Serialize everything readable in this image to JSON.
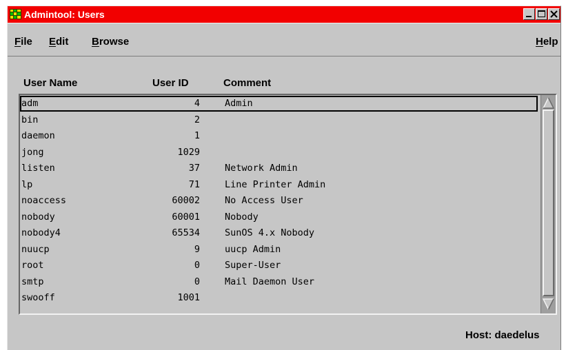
{
  "window": {
    "title": "Admintool: Users",
    "colors": {
      "titlebar": "#f20000",
      "title_text": "#ffffff",
      "background": "#c6c6c6"
    }
  },
  "menubar": {
    "file": {
      "mnemonic": "F",
      "rest": "ile"
    },
    "edit": {
      "mnemonic": "E",
      "rest": "dit"
    },
    "browse": {
      "mnemonic": "B",
      "rest": "rowse"
    },
    "help": {
      "mnemonic": "H",
      "rest": "elp"
    }
  },
  "table": {
    "columns": [
      "User Name",
      "User ID",
      "Comment"
    ],
    "selected_index": 0,
    "rows": [
      {
        "name": "adm",
        "id": "4",
        "comment": "Admin"
      },
      {
        "name": "bin",
        "id": "2",
        "comment": ""
      },
      {
        "name": "daemon",
        "id": "1",
        "comment": ""
      },
      {
        "name": "jong",
        "id": "1029",
        "comment": ""
      },
      {
        "name": "listen",
        "id": "37",
        "comment": "Network Admin"
      },
      {
        "name": "lp",
        "id": "71",
        "comment": "Line Printer Admin"
      },
      {
        "name": "noaccess",
        "id": "60002",
        "comment": "No Access User"
      },
      {
        "name": "nobody",
        "id": "60001",
        "comment": "Nobody"
      },
      {
        "name": "nobody4",
        "id": "65534",
        "comment": "SunOS 4.x Nobody"
      },
      {
        "name": "nuucp",
        "id": "9",
        "comment": "uucp Admin"
      },
      {
        "name": "root",
        "id": "0",
        "comment": "Super-User"
      },
      {
        "name": "smtp",
        "id": "0",
        "comment": "Mail Daemon User"
      },
      {
        "name": "swooff",
        "id": "1001",
        "comment": ""
      }
    ]
  },
  "status": {
    "host": "Host: daedelus"
  },
  "icons": {
    "app": "admintool-app-icon",
    "minimize": "minimize-icon",
    "maximize": "maximize-icon",
    "close": "close-icon",
    "scroll_up": "arrow-up-icon",
    "scroll_down": "arrow-down-icon"
  }
}
